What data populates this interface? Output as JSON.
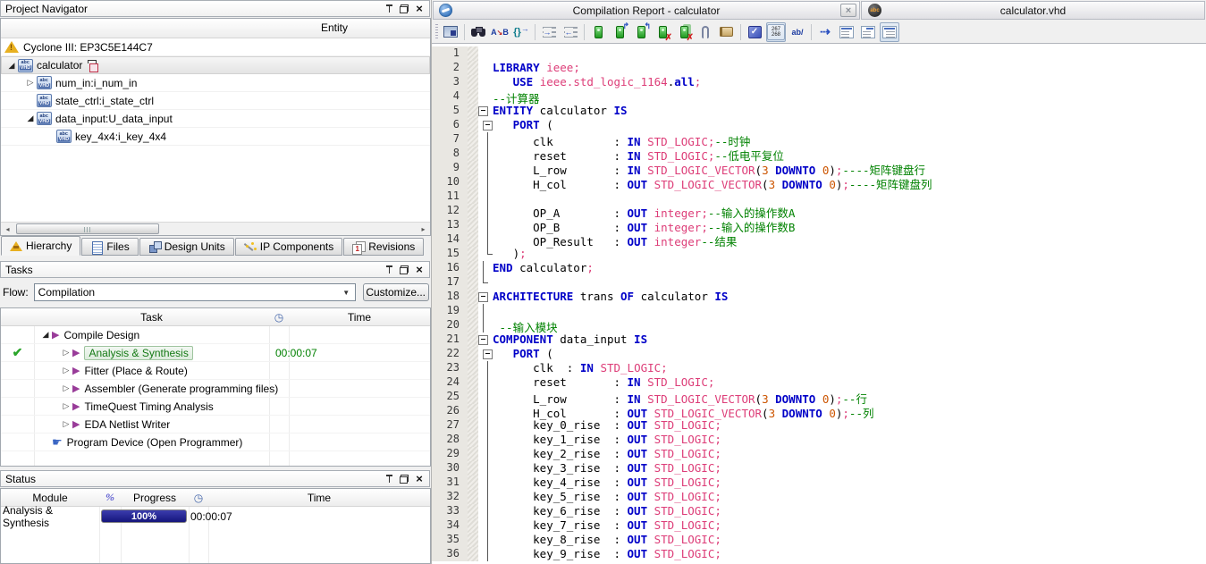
{
  "project_navigator": {
    "title": "Project Navigator",
    "column_header": "Entity",
    "tree": [
      {
        "label": "Cyclone III: EP3C5E144C7",
        "icon": "device-warning-icon",
        "indent": 0,
        "expander": "none"
      },
      {
        "label": "calculator",
        "icon": "vhd-file-icon",
        "indent": 0,
        "expander": "expanded",
        "selected": true,
        "badge": "entity-instance-icon"
      },
      {
        "label": "num_in:i_num_in",
        "icon": "vhd-file-icon",
        "indent": 1,
        "expander": "collapsed"
      },
      {
        "label": "state_ctrl:i_state_ctrl",
        "icon": "vhd-file-icon",
        "indent": 1,
        "expander": ""
      },
      {
        "label": "data_input:U_data_input",
        "icon": "vhd-file-icon",
        "indent": 1,
        "expander": "expanded"
      },
      {
        "label": "key_4x4:i_key_4x4",
        "icon": "vhd-file-icon",
        "indent": 2,
        "expander": ""
      }
    ],
    "tabs": [
      {
        "label": "Hierarchy",
        "icon": "hierarchy-icon",
        "active": true
      },
      {
        "label": "Files",
        "icon": "files-icon",
        "active": false
      },
      {
        "label": "Design Units",
        "icon": "design-units-icon",
        "active": false
      },
      {
        "label": "IP Components",
        "icon": "ip-components-icon",
        "active": false
      },
      {
        "label": "Revisions",
        "icon": "revisions-icon",
        "active": false
      }
    ]
  },
  "tasks": {
    "title": "Tasks",
    "flow_label": "Flow:",
    "flow_value": "Compilation",
    "customize_label": "Customize...",
    "columns": {
      "task": "Task",
      "time": "Time"
    },
    "rows": [
      {
        "label": "Compile Design",
        "indent": 0,
        "expander": "expanded",
        "icon": "play",
        "status": "",
        "time": ""
      },
      {
        "label": "Analysis & Synthesis",
        "indent": 1,
        "expander": "collapsed",
        "icon": "play",
        "status": "check",
        "selected": true,
        "time": "00:00:07"
      },
      {
        "label": "Fitter (Place & Route)",
        "indent": 1,
        "expander": "collapsed",
        "icon": "play",
        "status": "",
        "time": ""
      },
      {
        "label": "Assembler (Generate programming files)",
        "indent": 1,
        "expander": "collapsed",
        "icon": "play",
        "status": "",
        "time": ""
      },
      {
        "label": "TimeQuest Timing Analysis",
        "indent": 1,
        "expander": "collapsed",
        "icon": "play",
        "status": "",
        "time": ""
      },
      {
        "label": "EDA Netlist Writer",
        "indent": 1,
        "expander": "collapsed",
        "icon": "play",
        "status": "",
        "time": ""
      },
      {
        "label": "Program Device (Open Programmer)",
        "indent": 0,
        "expander": "",
        "icon": "hand",
        "status": "",
        "time": ""
      }
    ]
  },
  "status_panel": {
    "title": "Status",
    "columns": {
      "module": "Module",
      "percent": "%",
      "progress": "Progress",
      "time": "Time"
    },
    "rows": [
      {
        "module": "Analysis & Synthesis",
        "progress": "100%",
        "time": "00:00:07"
      }
    ]
  },
  "report_window": {
    "title": "Compilation Report - calculator"
  },
  "editor_window": {
    "title": "calculator.vhd"
  },
  "toolbar": {
    "line_numbers_top": "267",
    "line_numbers_bottom": "268",
    "word_wrap_label": "ab/",
    "find_replace_a": "A",
    "find_replace_b": "B",
    "brace_label": "{}",
    "spell_check_glyph": "✓",
    "icon_names": [
      "replace-dialog-icon",
      "find-icon",
      "find-replace-icon",
      "matching-brace-icon",
      "indent-increase-icon",
      "indent-decrease-icon",
      "bookmark-toggle-icon",
      "bookmark-next-icon",
      "bookmark-previous-icon",
      "bookmark-delete-icon",
      "bookmark-delete-all-icon",
      "attach-file-icon",
      "macro-icon",
      "spell-check-icon",
      "line-numbers-icon",
      "word-wrap-icon",
      "goto-line-icon",
      "block-style-1-icon",
      "block-style-2-icon",
      "block-style-3-icon"
    ]
  },
  "icons": {
    "vhd_top": "abc",
    "vhd_bottom": "VHD",
    "sphere_text": "abc"
  },
  "editor": {
    "lines": [
      {
        "n": 1,
        "f": "",
        "s": []
      },
      {
        "n": 2,
        "f": "",
        "s": [
          [
            "k",
            "LIBRARY"
          ],
          [
            "p",
            " "
          ],
          [
            "t",
            "ieee"
          ],
          [
            "s",
            ";"
          ]
        ]
      },
      {
        "n": 3,
        "f": "",
        "s": [
          [
            "p",
            "   "
          ],
          [
            "k",
            "USE"
          ],
          [
            "p",
            " "
          ],
          [
            "t",
            "ieee.std_logic_1164"
          ],
          [
            "p",
            "."
          ],
          [
            "k",
            "all"
          ],
          [
            "s",
            ";"
          ]
        ]
      },
      {
        "n": 4,
        "f": "",
        "s": [
          [
            "c",
            "--计算器"
          ]
        ]
      },
      {
        "n": 5,
        "f": "bo",
        "s": [
          [
            "k",
            "ENTITY"
          ],
          [
            "p",
            " calculator "
          ],
          [
            "k",
            "IS"
          ]
        ]
      },
      {
        "n": 6,
        "f": "bi",
        "s": [
          [
            "p",
            "   "
          ],
          [
            "k",
            "PORT"
          ],
          [
            "p",
            " ("
          ]
        ]
      },
      {
        "n": 7,
        "f": "li",
        "s": [
          [
            "p",
            "      clk         : "
          ],
          [
            "k",
            "IN"
          ],
          [
            "p",
            " "
          ],
          [
            "t",
            "STD_LOGIC"
          ],
          [
            "s",
            ";"
          ],
          [
            "c",
            "--时钟"
          ]
        ]
      },
      {
        "n": 8,
        "f": "li",
        "s": [
          [
            "p",
            "      reset       : "
          ],
          [
            "k",
            "IN"
          ],
          [
            "p",
            " "
          ],
          [
            "t",
            "STD_LOGIC"
          ],
          [
            "s",
            ";"
          ],
          [
            "c",
            "--低电平复位"
          ]
        ]
      },
      {
        "n": 9,
        "f": "li",
        "s": [
          [
            "p",
            "      L_row       : "
          ],
          [
            "k",
            "IN"
          ],
          [
            "p",
            " "
          ],
          [
            "t",
            "STD_LOGIC_VECTOR"
          ],
          [
            "p",
            "("
          ],
          [
            "n",
            "3"
          ],
          [
            "p",
            " "
          ],
          [
            "k",
            "DOWNTO"
          ],
          [
            "p",
            " "
          ],
          [
            "n",
            "0"
          ],
          [
            "p",
            ")"
          ],
          [
            "s",
            ";"
          ],
          [
            "c",
            "----矩阵键盘行"
          ]
        ]
      },
      {
        "n": 10,
        "f": "li",
        "s": [
          [
            "p",
            "      H_col       : "
          ],
          [
            "k",
            "OUT"
          ],
          [
            "p",
            " "
          ],
          [
            "t",
            "STD_LOGIC_VECTOR"
          ],
          [
            "p",
            "("
          ],
          [
            "n",
            "3"
          ],
          [
            "p",
            " "
          ],
          [
            "k",
            "DOWNTO"
          ],
          [
            "p",
            " "
          ],
          [
            "n",
            "0"
          ],
          [
            "p",
            ")"
          ],
          [
            "s",
            ";"
          ],
          [
            "c",
            "----矩阵键盘列"
          ]
        ]
      },
      {
        "n": 11,
        "f": "li",
        "s": []
      },
      {
        "n": 12,
        "f": "li",
        "s": [
          [
            "p",
            "      OP_A        : "
          ],
          [
            "k",
            "OUT"
          ],
          [
            "p",
            " "
          ],
          [
            "t",
            "integer"
          ],
          [
            "s",
            ";"
          ],
          [
            "c",
            "--输入的操作数A"
          ]
        ]
      },
      {
        "n": 13,
        "f": "li",
        "s": [
          [
            "p",
            "      OP_B        : "
          ],
          [
            "k",
            "OUT"
          ],
          [
            "p",
            " "
          ],
          [
            "t",
            "integer"
          ],
          [
            "s",
            ";"
          ],
          [
            "c",
            "--输入的操作数B"
          ]
        ]
      },
      {
        "n": 14,
        "f": "li",
        "s": [
          [
            "p",
            "      OP_Result   : "
          ],
          [
            "k",
            "OUT"
          ],
          [
            "p",
            " "
          ],
          [
            "t",
            "integer"
          ],
          [
            "c",
            "--结果"
          ]
        ]
      },
      {
        "n": 15,
        "f": "ei",
        "s": [
          [
            "p",
            "   )"
          ],
          [
            "s",
            ";"
          ]
        ]
      },
      {
        "n": 16,
        "f": "lo",
        "s": [
          [
            "k",
            "END"
          ],
          [
            "p",
            " calculator"
          ],
          [
            "s",
            ";"
          ]
        ]
      },
      {
        "n": 17,
        "f": "eo",
        "s": []
      },
      {
        "n": 18,
        "f": "bo",
        "s": [
          [
            "k",
            "ARCHITECTURE"
          ],
          [
            "p",
            " trans "
          ],
          [
            "k",
            "OF"
          ],
          [
            "p",
            " calculator "
          ],
          [
            "k",
            "IS"
          ]
        ]
      },
      {
        "n": 19,
        "f": "lo",
        "s": []
      },
      {
        "n": 20,
        "f": "lo",
        "s": [
          [
            "p",
            " "
          ],
          [
            "c",
            "--输入模块"
          ]
        ]
      },
      {
        "n": 21,
        "f": "bo",
        "s": [
          [
            "k",
            "COMPONENT"
          ],
          [
            "p",
            " data_input "
          ],
          [
            "k",
            "IS"
          ]
        ]
      },
      {
        "n": 22,
        "f": "bi",
        "s": [
          [
            "p",
            "   "
          ],
          [
            "k",
            "PORT"
          ],
          [
            "p",
            " ("
          ]
        ]
      },
      {
        "n": 23,
        "f": "li",
        "s": [
          [
            "p",
            "      clk  : "
          ],
          [
            "k",
            "IN"
          ],
          [
            "p",
            " "
          ],
          [
            "t",
            "STD_LOGIC"
          ],
          [
            "s",
            ";"
          ]
        ]
      },
      {
        "n": 24,
        "f": "li",
        "s": [
          [
            "p",
            "      reset       : "
          ],
          [
            "k",
            "IN"
          ],
          [
            "p",
            " "
          ],
          [
            "t",
            "STD_LOGIC"
          ],
          [
            "s",
            ";"
          ]
        ]
      },
      {
        "n": 25,
        "f": "li",
        "s": [
          [
            "p",
            "      L_row       : "
          ],
          [
            "k",
            "IN"
          ],
          [
            "p",
            " "
          ],
          [
            "t",
            "STD_LOGIC_VECTOR"
          ],
          [
            "p",
            "("
          ],
          [
            "n",
            "3"
          ],
          [
            "p",
            " "
          ],
          [
            "k",
            "DOWNTO"
          ],
          [
            "p",
            " "
          ],
          [
            "n",
            "0"
          ],
          [
            "p",
            ")"
          ],
          [
            "s",
            ";"
          ],
          [
            "c",
            "--行"
          ]
        ]
      },
      {
        "n": 26,
        "f": "li",
        "s": [
          [
            "p",
            "      H_col       : "
          ],
          [
            "k",
            "OUT"
          ],
          [
            "p",
            " "
          ],
          [
            "t",
            "STD_LOGIC_VECTOR"
          ],
          [
            "p",
            "("
          ],
          [
            "n",
            "3"
          ],
          [
            "p",
            " "
          ],
          [
            "k",
            "DOWNTO"
          ],
          [
            "p",
            " "
          ],
          [
            "n",
            "0"
          ],
          [
            "p",
            ")"
          ],
          [
            "s",
            ";"
          ],
          [
            "c",
            "--列"
          ]
        ]
      },
      {
        "n": 27,
        "f": "li",
        "s": [
          [
            "p",
            "      key_0_rise  : "
          ],
          [
            "k",
            "OUT"
          ],
          [
            "p",
            " "
          ],
          [
            "t",
            "STD_LOGIC"
          ],
          [
            "s",
            ";"
          ]
        ]
      },
      {
        "n": 28,
        "f": "li",
        "s": [
          [
            "p",
            "      key_1_rise  : "
          ],
          [
            "k",
            "OUT"
          ],
          [
            "p",
            " "
          ],
          [
            "t",
            "STD_LOGIC"
          ],
          [
            "s",
            ";"
          ]
        ]
      },
      {
        "n": 29,
        "f": "li",
        "s": [
          [
            "p",
            "      key_2_rise  : "
          ],
          [
            "k",
            "OUT"
          ],
          [
            "p",
            " "
          ],
          [
            "t",
            "STD_LOGIC"
          ],
          [
            "s",
            ";"
          ]
        ]
      },
      {
        "n": 30,
        "f": "li",
        "s": [
          [
            "p",
            "      key_3_rise  : "
          ],
          [
            "k",
            "OUT"
          ],
          [
            "p",
            " "
          ],
          [
            "t",
            "STD_LOGIC"
          ],
          [
            "s",
            ";"
          ]
        ]
      },
      {
        "n": 31,
        "f": "li",
        "s": [
          [
            "p",
            "      key_4_rise  : "
          ],
          [
            "k",
            "OUT"
          ],
          [
            "p",
            " "
          ],
          [
            "t",
            "STD_LOGIC"
          ],
          [
            "s",
            ";"
          ]
        ]
      },
      {
        "n": 32,
        "f": "li",
        "s": [
          [
            "p",
            "      key_5_rise  : "
          ],
          [
            "k",
            "OUT"
          ],
          [
            "p",
            " "
          ],
          [
            "t",
            "STD_LOGIC"
          ],
          [
            "s",
            ";"
          ]
        ]
      },
      {
        "n": 33,
        "f": "li",
        "s": [
          [
            "p",
            "      key_6_rise  : "
          ],
          [
            "k",
            "OUT"
          ],
          [
            "p",
            " "
          ],
          [
            "t",
            "STD_LOGIC"
          ],
          [
            "s",
            ";"
          ]
        ]
      },
      {
        "n": 34,
        "f": "li",
        "s": [
          [
            "p",
            "      key_7_rise  : "
          ],
          [
            "k",
            "OUT"
          ],
          [
            "p",
            " "
          ],
          [
            "t",
            "STD_LOGIC"
          ],
          [
            "s",
            ";"
          ]
        ]
      },
      {
        "n": 35,
        "f": "li",
        "s": [
          [
            "p",
            "      key_8_rise  : "
          ],
          [
            "k",
            "OUT"
          ],
          [
            "p",
            " "
          ],
          [
            "t",
            "STD_LOGIC"
          ],
          [
            "s",
            ";"
          ]
        ]
      },
      {
        "n": 36,
        "f": "li",
        "s": [
          [
            "p",
            "      key_9_rise  : "
          ],
          [
            "k",
            "OUT"
          ],
          [
            "p",
            " "
          ],
          [
            "t",
            "STD_LOGIC"
          ],
          [
            "s",
            ";"
          ]
        ]
      }
    ]
  }
}
